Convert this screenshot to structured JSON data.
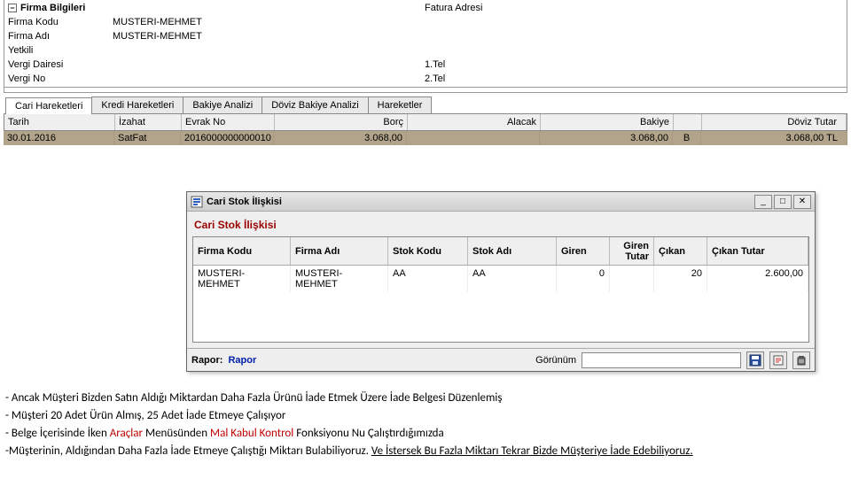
{
  "form": {
    "section_title": "Firma Bilgileri",
    "left": {
      "firma_kodu_lbl": "Firma Kodu",
      "firma_kodu_val": "MUSTERI-MEHMET",
      "firma_adi_lbl": "Firma Adı",
      "firma_adi_val": "MUSTERI-MEHMET",
      "yetkili_lbl": "Yetkili",
      "yetkili_val": "",
      "vergi_dairesi_lbl": "Vergi Dairesi",
      "vergi_dairesi_val": "",
      "vergi_no_lbl": "Vergi No",
      "vergi_no_val": ""
    },
    "right": {
      "fatura_adresi_lbl": "Fatura Adresi",
      "fatura_adresi_val": "",
      "tel1_lbl": "1.Tel",
      "tel1_val": "",
      "tel2_lbl": "2.Tel",
      "tel2_val": ""
    }
  },
  "tabs": {
    "t0": "Cari Hareketleri",
    "t1": "Kredi Hareketleri",
    "t2": "Bakiye Analizi",
    "t3": "Döviz Bakiye Analizi",
    "t4": "Hareketler"
  },
  "grid_header": {
    "tarih": "Tarih",
    "izahat": "İzahat",
    "evrak": "Evrak No",
    "borc": "Borç",
    "alacak": "Alacak",
    "bakiye": "Bakiye",
    "doviz": "Döviz Tutar"
  },
  "grid_row": {
    "tarih": "30.01.2016",
    "izahat": "SatFat",
    "evrak": "2016000000000010",
    "borc": "3.068,00",
    "alacak": "",
    "bakiye": "3.068,00",
    "bchar": "B",
    "doviz": "3.068,00 TL"
  },
  "inner": {
    "title": "Cari Stok İlişkisi",
    "subtitle": "Cari Stok İlişkisi",
    "head": {
      "firma_kodu": "Firma Kodu",
      "firma_adi": "Firma Adı",
      "stok_kodu": "Stok Kodu",
      "stok_adi": "Stok Adı",
      "giren": "Giren",
      "giren_tutar": "Giren Tutar",
      "cikan": "Çıkan",
      "cikan_tutar": "Çıkan Tutar"
    },
    "row": {
      "firma_kodu": "MUSTERI-MEHMET",
      "firma_adi": "MUSTERI-MEHMET",
      "stok_kodu": "AA",
      "stok_adi": "AA",
      "giren": "0",
      "giren_tutar": "",
      "cikan": "20",
      "cikan_tutar": "2.600,00"
    },
    "footer": {
      "rapor_lbl": "Rapor:",
      "rapor_val": "Rapor",
      "gorunum_lbl": "Görünüm",
      "gorunum_val": ""
    }
  },
  "paras": {
    "p1_a": "- Ancak Müşteri Bizden Satın Aldığı Miktardan Daha Fazla Ürünü İade Etmek Üzere İade Belgesi Düzenlemiş",
    "p2_a": "- Müşteri 20 Adet Ürün Almış, 25 Adet İade Etmeye Çalışıyor",
    "p3_a": "- Belge İçerisinde İken ",
    "p3_b": "Araçlar",
    "p3_c": " Menüsünden ",
    "p3_d": "Mal Kabul Kontrol",
    "p3_e": " Fonksiyonu Nu Çalıştırdığımızda",
    "p4_a": "-Müşterinin, Aldığından Daha Fazla İade Etmeye Çalıştığı Miktarı Bulabiliyoruz. ",
    "p4_b": "Ve İstersek Bu Fazla Miktarı Tekrar Bizde Müşteriye İade Edebiliyoruz."
  }
}
